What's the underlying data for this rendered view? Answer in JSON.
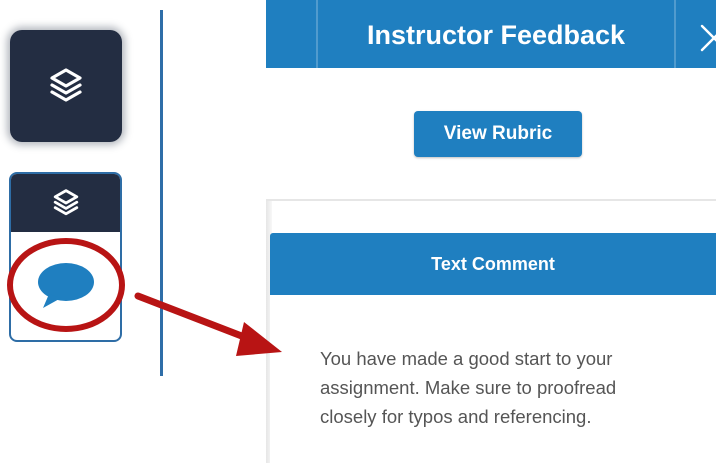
{
  "tools": [
    {
      "icon": "layers-icon"
    },
    {
      "icon": "layers-icon",
      "sub_icon": "speech-bubble-icon"
    }
  ],
  "panel": {
    "title": "Instructor Feedback",
    "close_icon": "close-icon",
    "view_rubric_label": "View Rubric",
    "comment_section": {
      "heading": "Text Comment",
      "lines": [
        "You have made a good start to your",
        "assignment. Make sure to proofread",
        "closely for typos and referencing."
      ]
    }
  },
  "annotation": {
    "color": "#b81414"
  },
  "colors": {
    "primary": "#1f7fc0",
    "dark_tool": "#232d42",
    "divider": "#2f6ea8"
  }
}
